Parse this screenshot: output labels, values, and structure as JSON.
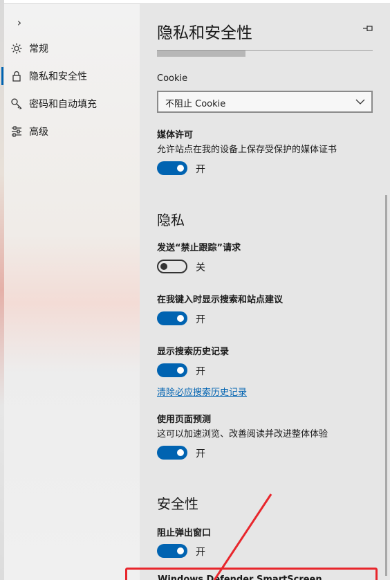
{
  "nav": {
    "items": [
      {
        "label": "常规",
        "icon": "gear-icon"
      },
      {
        "label": "隐私和安全性",
        "icon": "lock-icon"
      },
      {
        "label": "密码和自动填充",
        "icon": "key-icon"
      },
      {
        "label": "高级",
        "icon": "sliders-icon"
      }
    ],
    "active_index": 1
  },
  "panel": {
    "title": "隐私和安全性",
    "load_progress": 0.41,
    "cookie": {
      "label": "Cookie",
      "selected": "不阻止 Cookie"
    },
    "media": {
      "label": "媒体许可",
      "description": "允许站点在我的设备上保存受保护的媒体证书",
      "state": "开"
    },
    "privacy_heading": "隐私",
    "dnt": {
      "label": "发送“禁止跟踪”请求",
      "state": "关"
    },
    "suggest": {
      "label": "在我键入时显示搜索和站点建议",
      "state": "开"
    },
    "history": {
      "label": "显示搜索历史记录",
      "state": "开",
      "clear_link": "清除必应搜索历史记录"
    },
    "predict": {
      "label": "使用页面预测",
      "description": "这可以加速浏览、改善阅读并改进整体体验",
      "state": "开"
    },
    "security_heading": "安全性",
    "popup": {
      "label": "阻止弹出窗口",
      "state": "开"
    },
    "partial_label": "Windows Defender SmartScreen"
  },
  "colors": {
    "accent": "#0063b1",
    "annotation": "#e8262c"
  }
}
